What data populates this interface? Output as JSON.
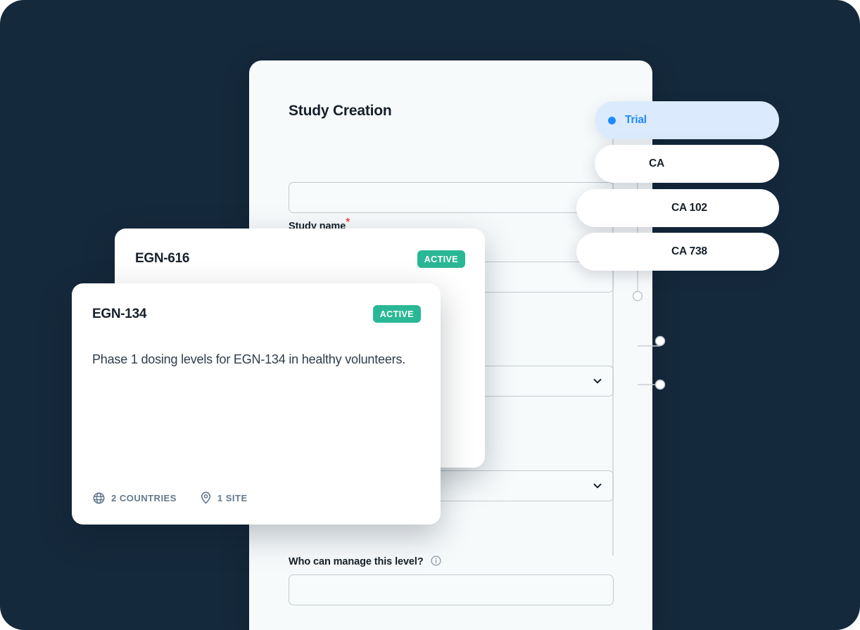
{
  "theme": {
    "canvas_bg": "#15293c",
    "panel_bg": "#f7fafb",
    "accent_blue": "#1f8aff",
    "selected_pill_bg": "#dbebfd",
    "badge_green": "#2ab795",
    "required_red": "#ff3b4e",
    "meta_gray": "#65788c"
  },
  "form": {
    "title": "Study Creation",
    "study_name_label": "Study name",
    "study_name_required_mark": "*",
    "study_name_value": "",
    "study_name_placeholder": "",
    "hidden_field_value": "",
    "select_one_value": "",
    "select_two_value": "",
    "manage_label": "Who can manage this level?",
    "manage_info_icon": "info-circle-icon",
    "manage_value": "",
    "manage_placeholder": "",
    "chevron_icon": "chevron-down-icon"
  },
  "tree": {
    "items": [
      {
        "label": "Trial",
        "selected": true,
        "node": "filled-dot",
        "depth": 0
      },
      {
        "label": "CA",
        "selected": false,
        "node": "hollow-circle",
        "depth": 1
      },
      {
        "label": "CA 102",
        "selected": false,
        "node": "hollow-circle",
        "depth": 2
      },
      {
        "label": "CA 738",
        "selected": false,
        "node": "hollow-circle",
        "depth": 2
      }
    ]
  },
  "cards": [
    {
      "title": "EGN-616",
      "status": "ACTIVE",
      "description": "",
      "countries": "",
      "sites": ""
    },
    {
      "title": "EGN-134",
      "status": "ACTIVE",
      "description": "Phase 1 dosing levels for EGN-134 in healthy volunteers.",
      "countries": "2 COUNTRIES",
      "sites": "1 SITE",
      "countries_icon": "globe-icon",
      "sites_icon": "map-pin-icon"
    }
  ]
}
